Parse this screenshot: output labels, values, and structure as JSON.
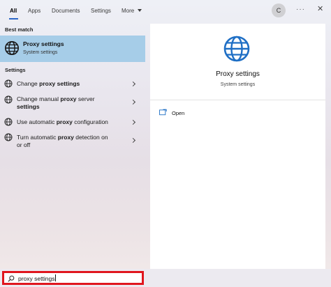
{
  "nav": {
    "tabs": [
      "All",
      "Apps",
      "Documents",
      "Settings",
      "More"
    ],
    "avatar_initial": "C",
    "more_options": "···",
    "close": "✕"
  },
  "best_match": {
    "heading": "Best match",
    "title": "Proxy settings",
    "subtitle": "System settings",
    "icon": "globe-icon"
  },
  "settings_section": {
    "heading": "Settings",
    "items": [
      {
        "prefix": "Change ",
        "bold": "proxy settings",
        "line2_prefix": "",
        "line2_bold": "",
        "line2_suffix": "",
        "icon": "globe-icon"
      },
      {
        "prefix": "Change manual ",
        "bold": "proxy",
        "suffix": " server",
        "line2_bold": "settings",
        "icon": "globe-icon"
      },
      {
        "prefix": "Use automatic ",
        "bold": "proxy",
        "suffix": " configuration",
        "icon": "globe-icon"
      },
      {
        "prefix": "Turn automatic ",
        "bold": "proxy",
        "suffix": " detection on",
        "line2_suffix": "or off",
        "icon": "globe-icon"
      }
    ]
  },
  "detail": {
    "title": "Proxy settings",
    "subtitle": "System settings",
    "actions": [
      {
        "label": "Open",
        "icon": "open-window-icon"
      }
    ]
  },
  "search": {
    "value": "proxy settings",
    "icon": "search-icon"
  },
  "colors": {
    "accent": "#2b66c7",
    "selection": "#a6cde8",
    "search_highlight_border": "#e0161e"
  }
}
